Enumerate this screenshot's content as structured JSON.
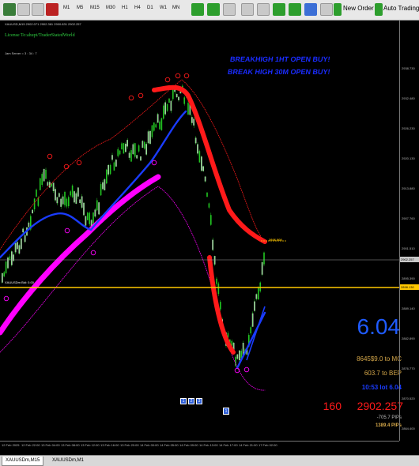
{
  "toolbar": {
    "timeframes": [
      "M1",
      "M5",
      "M15",
      "M30",
      "H1",
      "H4",
      "D1",
      "W1",
      "MN"
    ],
    "new_order_label": "New Order",
    "auto_trading_label": "Auto Trading"
  },
  "chart": {
    "symbol_line": "XAUUSD,M15 2902.071 2902.361 2900.831 2902.257",
    "license": "License To:ahupt/TraderStatedWorld",
    "server_time": "Jam Server = 3 : 34 : 7",
    "headline_1": "BREAKHIGH 1HT OPEN BUY!",
    "headline_2": "BREAK HIGH 30M OPEN BUY!",
    "level_label": "XAUUSDm Bid: 0.00",
    "target_tag": "2926.000",
    "big_number": "6.04",
    "panel": {
      "line1": "8645$9.0  to MC",
      "line2": "603.7  to BEP",
      "line3": "10:53  lot  6.04",
      "spread": "160",
      "price": "2902.257",
      "pips1": "-705.7 PIPs",
      "pips2": "1389.4 PIPs"
    },
    "buttons": [
      "1",
      "2",
      "3"
    ],
    "bottom_button": "1",
    "price_labels": [
      "2938.730",
      "2932.480",
      "2926.230",
      "2920.130",
      "2913.880",
      "2907.760",
      "2901.510",
      "2895.390",
      "2889.140",
      "2882.890",
      "2876.770",
      "2870.520",
      "2864.400"
    ],
    "current_price": "2902.257",
    "level_price": "2898.130",
    "time_labels": [
      "12 Feb 2025",
      "12 Feb 22:00",
      "13 Feb 04:00",
      "13 Feb 08:00",
      "13 Feb 12:00",
      "13 Feb 16:00",
      "13 Feb 20:00",
      "14 Feb 00:00",
      "14 Feb 05:00",
      "14 Feb 09:00",
      "14 Feb 13:00",
      "14 Feb 17:00",
      "14 Feb 21:00",
      "17 Feb 02:00"
    ]
  },
  "tabs": [
    "XAUUSDm,M15",
    "XAUUSDm,M1"
  ],
  "colors": {
    "upper_band": "#ff1a1a",
    "lower_band": "#ff00ff",
    "fast_line": "#1a3cff",
    "candles": "#22c722",
    "level_line": "#ffc800",
    "headline": "#1a2cff"
  }
}
